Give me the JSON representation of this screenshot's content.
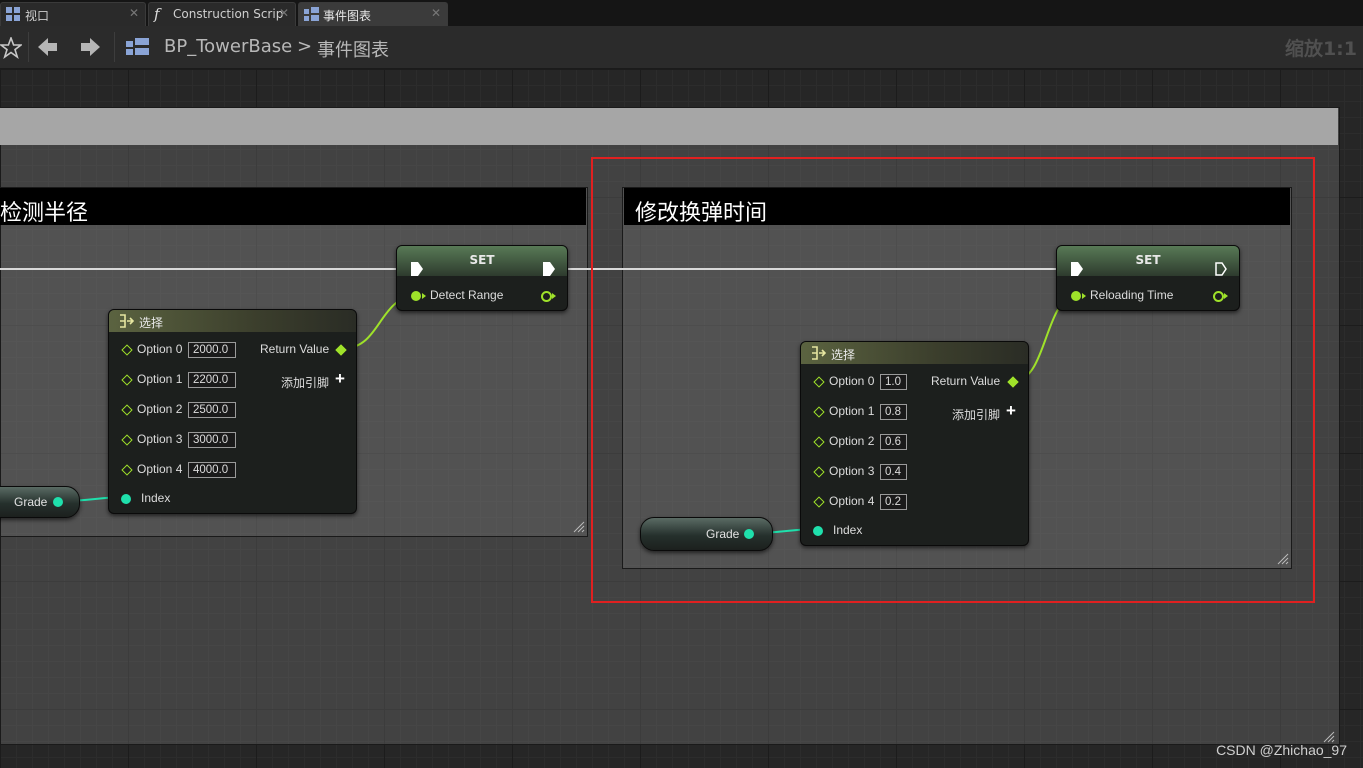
{
  "tabs": [
    {
      "label": "视口",
      "icon": "grid-icon",
      "active": false
    },
    {
      "label": "Construction Scrip",
      "icon": "function-icon",
      "active": false
    },
    {
      "label": "事件图表",
      "icon": "grid-icon",
      "active": true
    }
  ],
  "toolbar": {
    "breadcrumb_blueprint": "BP_TowerBase",
    "breadcrumb_separator": ">",
    "breadcrumb_graph": "事件图表",
    "zoom": "缩放1:1"
  },
  "graph": {
    "comment_left": {
      "title": "检测半径"
    },
    "comment_right": {
      "title": "修改换弹时间"
    },
    "left_select": {
      "title": "选择",
      "options": [
        {
          "label": "Option 0",
          "value": "2000.0"
        },
        {
          "label": "Option 1",
          "value": "2200.0"
        },
        {
          "label": "Option 2",
          "value": "2500.0"
        },
        {
          "label": "Option 3",
          "value": "3000.0"
        },
        {
          "label": "Option 4",
          "value": "4000.0"
        }
      ],
      "return_label": "Return Value",
      "add_pin_label": "添加引脚",
      "index_label": "Index"
    },
    "right_select": {
      "title": "选择",
      "options": [
        {
          "label": "Option 0",
          "value": "1.0"
        },
        {
          "label": "Option 1",
          "value": "0.8"
        },
        {
          "label": "Option 2",
          "value": "0.6"
        },
        {
          "label": "Option 3",
          "value": "0.4"
        },
        {
          "label": "Option 4",
          "value": "0.2"
        }
      ],
      "return_label": "Return Value",
      "add_pin_label": "添加引脚",
      "index_label": "Index"
    },
    "left_set": {
      "title": "SET",
      "pin_label": "Detect Range"
    },
    "right_set": {
      "title": "SET",
      "pin_label": "Reloading Time"
    },
    "left_grade": {
      "label": "Grade"
    },
    "right_grade": {
      "label": "Grade"
    }
  },
  "colors": {
    "exec_wire": "#e0e0e0",
    "float_pin": "#9fe22a",
    "int_pin": "#1fe0ac",
    "highlight_box": "#e02020"
  },
  "watermark": "CSDN @Zhichao_97"
}
